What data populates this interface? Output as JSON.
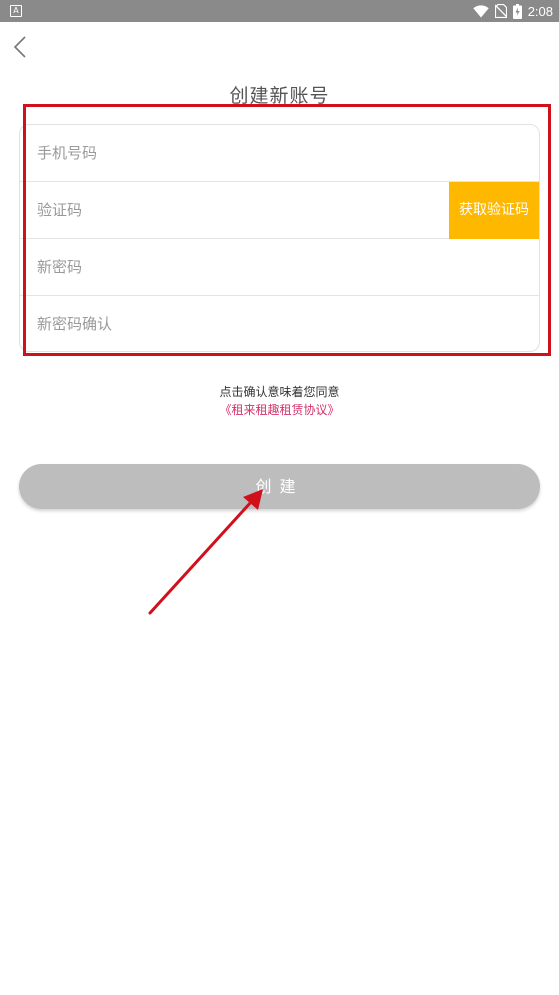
{
  "status_bar": {
    "app_badge": "A",
    "time": "2:08"
  },
  "header": {
    "title": "创建新账号"
  },
  "form": {
    "phone_placeholder": "手机号码",
    "code_placeholder": "验证码",
    "get_code_label": "获取验证码",
    "password_placeholder": "新密码",
    "confirm_placeholder": "新密码确认"
  },
  "agreement": {
    "text": "点击确认意味着您同意",
    "link": "《租来租趣租赁协议》"
  },
  "actions": {
    "create_label": "创建"
  },
  "colors": {
    "status_bar": "#8a8a8a",
    "accent_yellow": "#ffb800",
    "link_pink": "#d5316b",
    "button_gray": "#bdbdbd",
    "annotation_red": "#d0111b"
  },
  "icons": [
    "back-chevron-icon",
    "wifi-icon",
    "no-sim-icon",
    "battery-charging-icon"
  ]
}
